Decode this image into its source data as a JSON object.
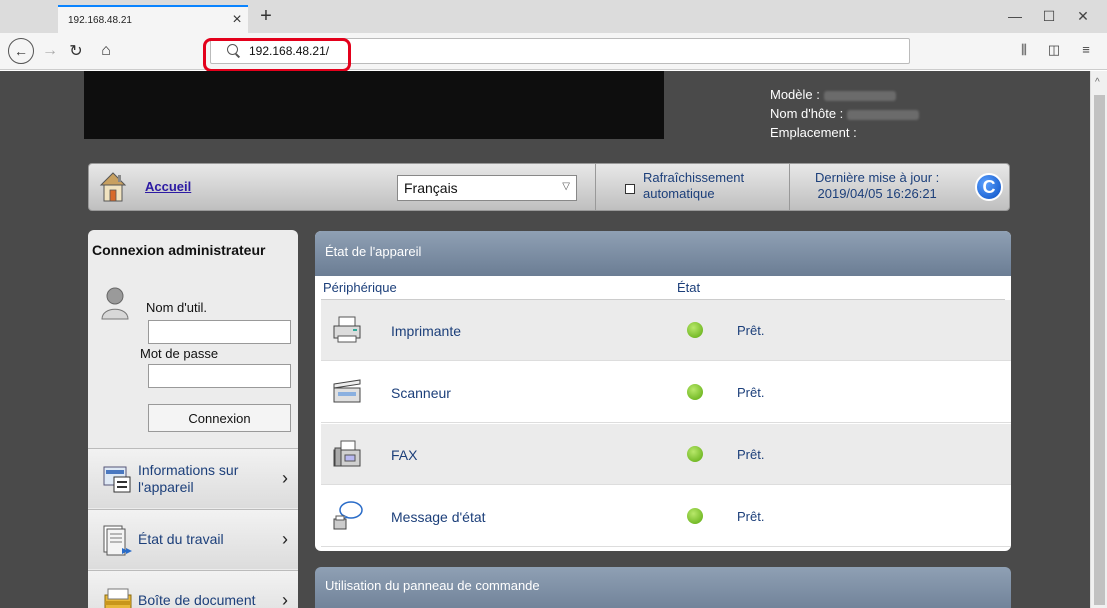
{
  "browser": {
    "tab_title": "192.168.48.21",
    "tab_close": "×",
    "new_tab": "+",
    "url": "192.168.48.21/",
    "window_controls": [
      "—",
      "☐",
      "✕"
    ]
  },
  "device": {
    "model_label": "Modèle :",
    "hostname_label": "Nom d'hôte :",
    "location_label": "Emplacement :"
  },
  "topbar": {
    "home_label": "Accueil",
    "language": "Français",
    "autorefresh_line1": "Rafraîchissement",
    "autorefresh_line2": "automatique",
    "lastupdate_label": "Dernière mise à jour :",
    "lastupdate_value": "2019/04/05 16:26:21",
    "refresh_icon": "C"
  },
  "login": {
    "title": "Connexion administrateur",
    "username_label": "Nom d'util.",
    "password_label": "Mot de passe",
    "button": "Connexion"
  },
  "menu": {
    "items": [
      {
        "label": "Informations sur l'appareil",
        "icon": "device-info-icon"
      },
      {
        "label": "État du travail",
        "icon": "job-status-icon"
      },
      {
        "label": "Boîte de document",
        "icon": "document-box-icon"
      }
    ],
    "chevron": "›"
  },
  "device_status": {
    "title": "État de l'appareil",
    "col_device": "Périphérique",
    "col_state": "État",
    "rows": [
      {
        "name": "Imprimante",
        "state": "Prêt.",
        "icon": "printer-icon"
      },
      {
        "name": "Scanneur",
        "state": "Prêt.",
        "icon": "scanner-icon"
      },
      {
        "name": "FAX",
        "state": "Prêt.",
        "icon": "fax-icon"
      },
      {
        "name": "Message d'état",
        "state": "Prêt.",
        "icon": "status-message-icon"
      }
    ],
    "status_color": "#6cc018"
  },
  "panel_usage": {
    "title": "Utilisation du panneau de commande"
  },
  "colors": {
    "highlight": "#e3001b",
    "link": "#2c1aa3",
    "text_blue": "#1c3f7a"
  }
}
